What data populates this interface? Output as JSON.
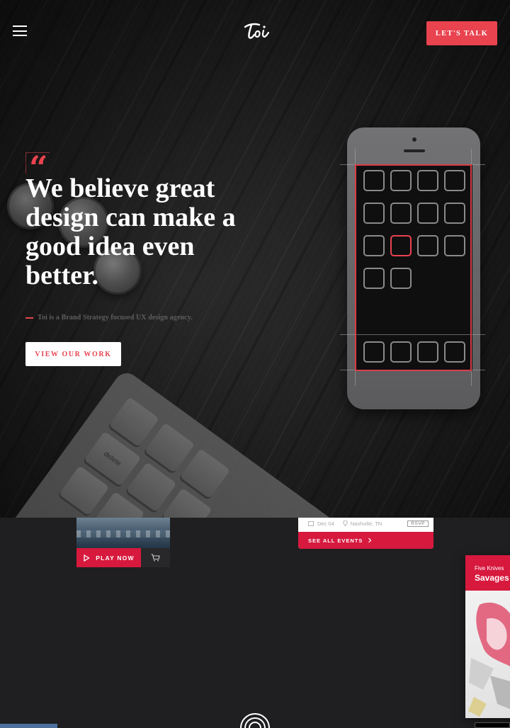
{
  "header": {
    "menu_icon": "hamburger-menu-icon",
    "logo_text": "toi",
    "cta_label": "LET'S TALK"
  },
  "hero": {
    "quote_mark": "“",
    "headline": "We believe great design can make a good idea even better.",
    "tagline": "Toi is a Brand Strategy focused UX design agency.",
    "cta_label": "VIEW OUR WORK",
    "keyboard_keys": [
      "delete"
    ]
  },
  "showcase": {
    "game_card": {
      "play_label": "PLAY NOW",
      "play_icon": "play-triangle-icon",
      "cart_icon": "shopping-cart-icon"
    },
    "event_card": {
      "date": "Dec 04",
      "location": "Nashville, TN",
      "rsvp_label": "RSVP",
      "see_all_label": "SEE ALL EVENTS",
      "see_all_icon": "chevron-right-icon"
    },
    "album_card": {
      "artist": "Five Knives",
      "title": "Savages"
    }
  },
  "colors": {
    "accent": "#e8434f",
    "brand_red": "#d7193e",
    "background": "#1f1f21"
  }
}
